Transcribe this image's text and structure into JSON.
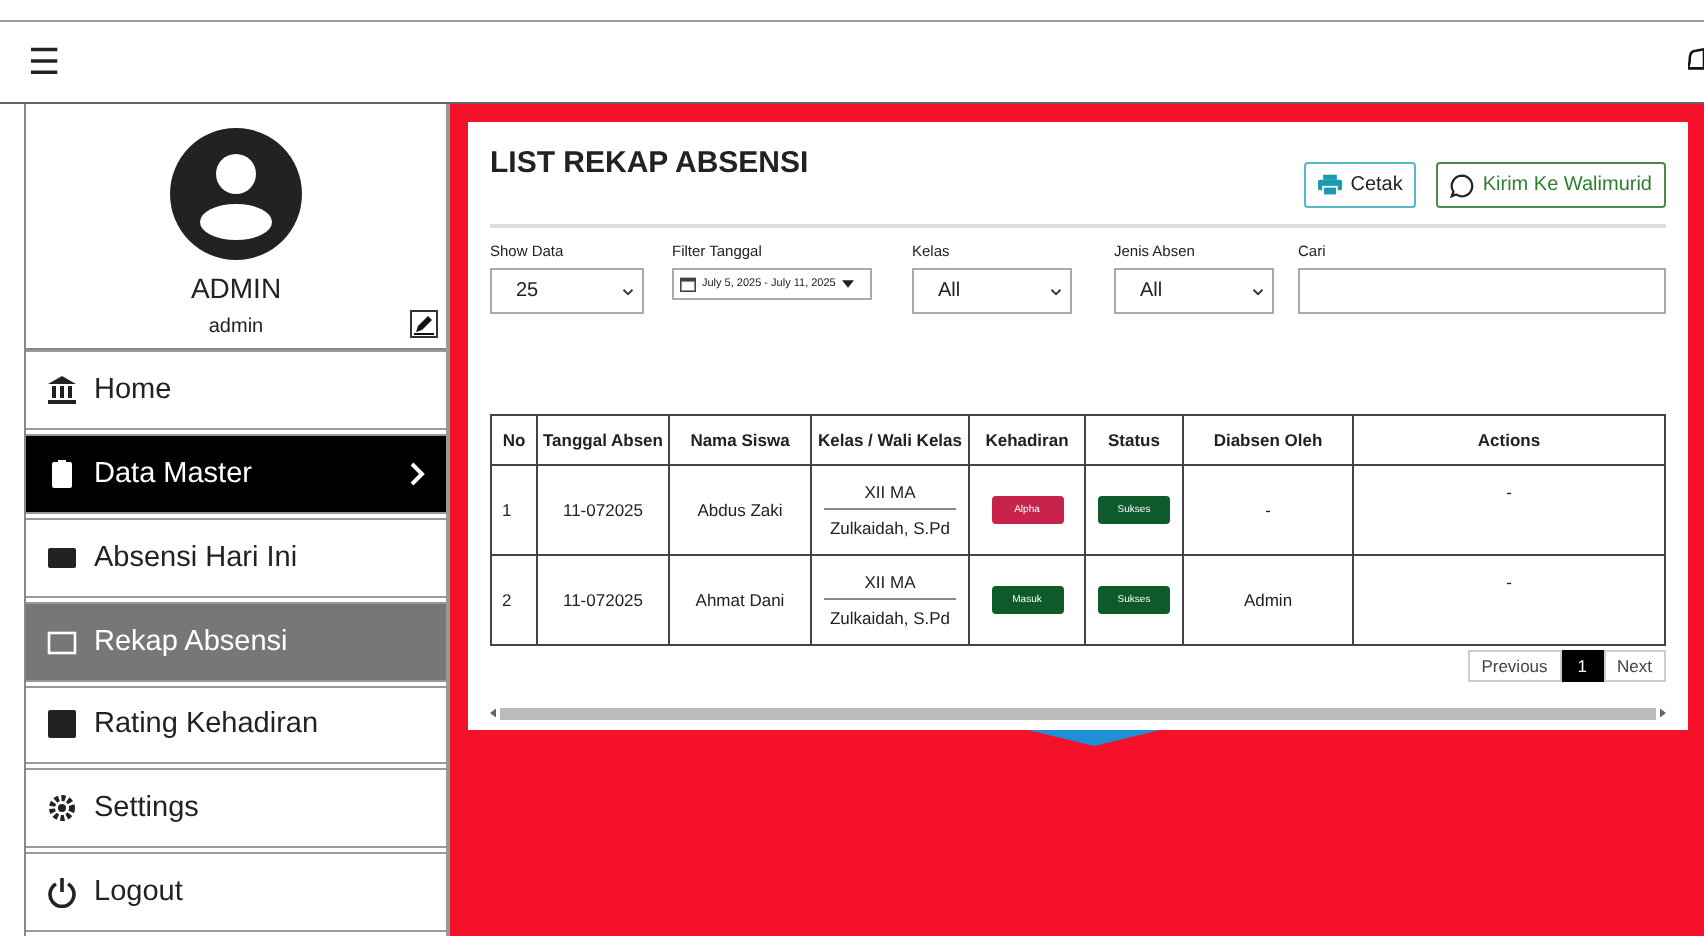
{
  "header": {
    "menu_glyph": "☰"
  },
  "profile": {
    "name": "ADMIN",
    "username": "admin"
  },
  "sidebar": {
    "items": [
      {
        "label": "Home",
        "selected": false,
        "highlighted": false,
        "has_submenu": false
      },
      {
        "label": "Data Master",
        "selected": false,
        "highlighted": true,
        "has_submenu": true
      },
      {
        "label": "Absensi Hari Ini",
        "selected": false,
        "highlighted": false,
        "has_submenu": false
      },
      {
        "label": "Rekap Absensi",
        "selected": true,
        "highlighted": false,
        "has_submenu": false
      },
      {
        "label": "Rating Kehadiran",
        "selected": false,
        "highlighted": false,
        "has_submenu": false
      },
      {
        "label": "Settings",
        "selected": false,
        "highlighted": false,
        "has_submenu": false
      },
      {
        "label": "Logout",
        "selected": false,
        "highlighted": false,
        "has_submenu": false
      }
    ]
  },
  "card": {
    "title": "LIST REKAP ABSENSI",
    "buttons": [
      {
        "label": "Cetak",
        "kind": "print"
      },
      {
        "label": "Kirim Ke Walimurid",
        "kind": "whatsapp"
      }
    ],
    "filters": [
      {
        "label": "Show Data",
        "kind": "select",
        "value": "25"
      },
      {
        "label": "Filter Tanggal",
        "kind": "daterange",
        "value": "July 5, 2025 - July 11, 2025"
      },
      {
        "label": "Kelas",
        "kind": "select",
        "value": "All"
      },
      {
        "label": "Jenis Absen",
        "kind": "select",
        "value": "All"
      },
      {
        "label": "Cari",
        "kind": "text"
      }
    ],
    "table": {
      "columns": [
        "No",
        "Tanggal Absen",
        "Nama Siswa",
        "Kelas / Wali Kelas",
        "Kehadiran",
        "Status",
        "Diabsen Oleh",
        "Actions"
      ],
      "rows": [
        {
          "no": "1",
          "date": "11-072025",
          "name": "Abdus Zaki",
          "kelas": "XII MA",
          "wali": "Zulkaidah, S.Pd",
          "kehadiran": {
            "text": "Alpha",
            "color": "#c8234a"
          },
          "status": {
            "text": "Sukses",
            "color": "#0e5a2a"
          },
          "by": "-",
          "actions": "-"
        },
        {
          "no": "2",
          "date": "11-072025",
          "name": "Ahmat Dani",
          "kelas": "XII MA",
          "wali": "Zulkaidah, S.Pd",
          "kehadiran": {
            "text": "Masuk",
            "color": "#0e5a2a"
          },
          "status": {
            "text": "Sukses",
            "color": "#0e5a2a"
          },
          "by": "Admin",
          "actions": "-"
        }
      ]
    },
    "pagination": [
      {
        "label": "Previous",
        "selected": false
      },
      {
        "label": "1",
        "selected": true
      },
      {
        "label": "Next",
        "selected": false
      }
    ]
  }
}
